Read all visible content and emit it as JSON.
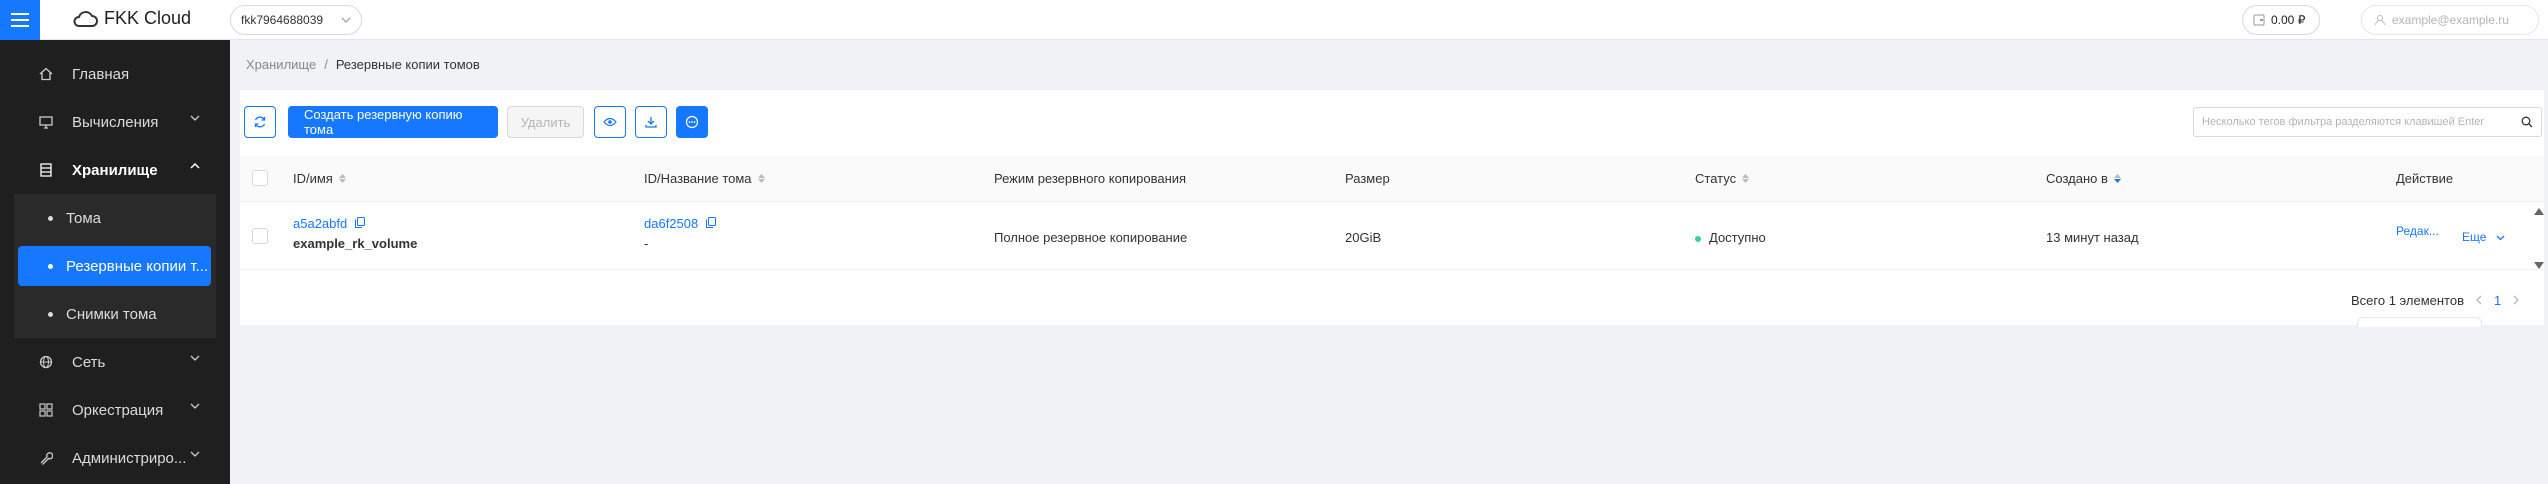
{
  "header": {
    "logo_text": "FKK Cloud",
    "project_id": "fkk7964688039",
    "balance": "0.00 ₽",
    "user_email": "example@example.ru"
  },
  "sidebar": {
    "items": [
      {
        "label": "Главная",
        "icon": "home-icon"
      },
      {
        "label": "Вычисления",
        "icon": "monitor-icon"
      },
      {
        "label": "Хранилище",
        "icon": "storage-icon"
      },
      {
        "label": "Сеть",
        "icon": "globe-icon"
      },
      {
        "label": "Оркестрация",
        "icon": "grid-icon"
      },
      {
        "label": "Администриро...",
        "icon": "wrench-icon"
      }
    ],
    "sub_items": [
      {
        "label": "Тома"
      },
      {
        "label": "Резервные копии т..."
      },
      {
        "label": "Снимки тома"
      }
    ]
  },
  "breadcrumb": {
    "parent": "Хранилище",
    "separator": "/",
    "current": "Резервные копии томов"
  },
  "toolbar": {
    "create_label": "Создать резервную копию тома",
    "delete_label": "Удалить",
    "search_placeholder": "Несколько тегов фильтра разделяются клавишей Enter"
  },
  "table": {
    "columns": [
      "ID/имя",
      "ID/Название тома",
      "Режим резервного копирования",
      "Размер",
      "Статус",
      "Создано в",
      "Действие"
    ],
    "rows": [
      {
        "id": "a5a2abfd",
        "name": "example_rk_volume",
        "volume_id": "da6f2508",
        "volume_name": "-",
        "mode": "Полное резервное копирование",
        "size": "20GiB",
        "status": "Доступно",
        "created": "13 минут назад",
        "action_edit": "Редак...",
        "action_more": "Еще"
      }
    ]
  },
  "pagination": {
    "total": "Всего 1 элементов",
    "page": "1"
  },
  "colors": {
    "accent": "#1677ff",
    "sidebar_bg": "#1f1f1f",
    "status_ok": "#3ccf8e"
  }
}
